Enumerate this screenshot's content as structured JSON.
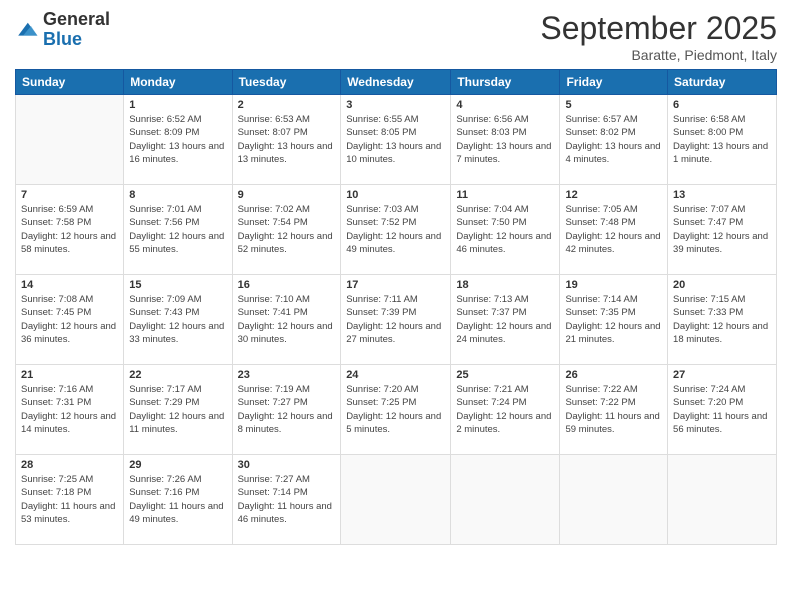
{
  "logo": {
    "general": "General",
    "blue": "Blue"
  },
  "header": {
    "month": "September 2025",
    "location": "Baratte, Piedmont, Italy"
  },
  "days_of_week": [
    "Sunday",
    "Monday",
    "Tuesday",
    "Wednesday",
    "Thursday",
    "Friday",
    "Saturday"
  ],
  "weeks": [
    [
      {
        "day": "",
        "sunrise": "",
        "sunset": "",
        "daylight": ""
      },
      {
        "day": "1",
        "sunrise": "Sunrise: 6:52 AM",
        "sunset": "Sunset: 8:09 PM",
        "daylight": "Daylight: 13 hours and 16 minutes."
      },
      {
        "day": "2",
        "sunrise": "Sunrise: 6:53 AM",
        "sunset": "Sunset: 8:07 PM",
        "daylight": "Daylight: 13 hours and 13 minutes."
      },
      {
        "day": "3",
        "sunrise": "Sunrise: 6:55 AM",
        "sunset": "Sunset: 8:05 PM",
        "daylight": "Daylight: 13 hours and 10 minutes."
      },
      {
        "day": "4",
        "sunrise": "Sunrise: 6:56 AM",
        "sunset": "Sunset: 8:03 PM",
        "daylight": "Daylight: 13 hours and 7 minutes."
      },
      {
        "day": "5",
        "sunrise": "Sunrise: 6:57 AM",
        "sunset": "Sunset: 8:02 PM",
        "daylight": "Daylight: 13 hours and 4 minutes."
      },
      {
        "day": "6",
        "sunrise": "Sunrise: 6:58 AM",
        "sunset": "Sunset: 8:00 PM",
        "daylight": "Daylight: 13 hours and 1 minute."
      }
    ],
    [
      {
        "day": "7",
        "sunrise": "Sunrise: 6:59 AM",
        "sunset": "Sunset: 7:58 PM",
        "daylight": "Daylight: 12 hours and 58 minutes."
      },
      {
        "day": "8",
        "sunrise": "Sunrise: 7:01 AM",
        "sunset": "Sunset: 7:56 PM",
        "daylight": "Daylight: 12 hours and 55 minutes."
      },
      {
        "day": "9",
        "sunrise": "Sunrise: 7:02 AM",
        "sunset": "Sunset: 7:54 PM",
        "daylight": "Daylight: 12 hours and 52 minutes."
      },
      {
        "day": "10",
        "sunrise": "Sunrise: 7:03 AM",
        "sunset": "Sunset: 7:52 PM",
        "daylight": "Daylight: 12 hours and 49 minutes."
      },
      {
        "day": "11",
        "sunrise": "Sunrise: 7:04 AM",
        "sunset": "Sunset: 7:50 PM",
        "daylight": "Daylight: 12 hours and 46 minutes."
      },
      {
        "day": "12",
        "sunrise": "Sunrise: 7:05 AM",
        "sunset": "Sunset: 7:48 PM",
        "daylight": "Daylight: 12 hours and 42 minutes."
      },
      {
        "day": "13",
        "sunrise": "Sunrise: 7:07 AM",
        "sunset": "Sunset: 7:47 PM",
        "daylight": "Daylight: 12 hours and 39 minutes."
      }
    ],
    [
      {
        "day": "14",
        "sunrise": "Sunrise: 7:08 AM",
        "sunset": "Sunset: 7:45 PM",
        "daylight": "Daylight: 12 hours and 36 minutes."
      },
      {
        "day": "15",
        "sunrise": "Sunrise: 7:09 AM",
        "sunset": "Sunset: 7:43 PM",
        "daylight": "Daylight: 12 hours and 33 minutes."
      },
      {
        "day": "16",
        "sunrise": "Sunrise: 7:10 AM",
        "sunset": "Sunset: 7:41 PM",
        "daylight": "Daylight: 12 hours and 30 minutes."
      },
      {
        "day": "17",
        "sunrise": "Sunrise: 7:11 AM",
        "sunset": "Sunset: 7:39 PM",
        "daylight": "Daylight: 12 hours and 27 minutes."
      },
      {
        "day": "18",
        "sunrise": "Sunrise: 7:13 AM",
        "sunset": "Sunset: 7:37 PM",
        "daylight": "Daylight: 12 hours and 24 minutes."
      },
      {
        "day": "19",
        "sunrise": "Sunrise: 7:14 AM",
        "sunset": "Sunset: 7:35 PM",
        "daylight": "Daylight: 12 hours and 21 minutes."
      },
      {
        "day": "20",
        "sunrise": "Sunrise: 7:15 AM",
        "sunset": "Sunset: 7:33 PM",
        "daylight": "Daylight: 12 hours and 18 minutes."
      }
    ],
    [
      {
        "day": "21",
        "sunrise": "Sunrise: 7:16 AM",
        "sunset": "Sunset: 7:31 PM",
        "daylight": "Daylight: 12 hours and 14 minutes."
      },
      {
        "day": "22",
        "sunrise": "Sunrise: 7:17 AM",
        "sunset": "Sunset: 7:29 PM",
        "daylight": "Daylight: 12 hours and 11 minutes."
      },
      {
        "day": "23",
        "sunrise": "Sunrise: 7:19 AM",
        "sunset": "Sunset: 7:27 PM",
        "daylight": "Daylight: 12 hours and 8 minutes."
      },
      {
        "day": "24",
        "sunrise": "Sunrise: 7:20 AM",
        "sunset": "Sunset: 7:25 PM",
        "daylight": "Daylight: 12 hours and 5 minutes."
      },
      {
        "day": "25",
        "sunrise": "Sunrise: 7:21 AM",
        "sunset": "Sunset: 7:24 PM",
        "daylight": "Daylight: 12 hours and 2 minutes."
      },
      {
        "day": "26",
        "sunrise": "Sunrise: 7:22 AM",
        "sunset": "Sunset: 7:22 PM",
        "daylight": "Daylight: 11 hours and 59 minutes."
      },
      {
        "day": "27",
        "sunrise": "Sunrise: 7:24 AM",
        "sunset": "Sunset: 7:20 PM",
        "daylight": "Daylight: 11 hours and 56 minutes."
      }
    ],
    [
      {
        "day": "28",
        "sunrise": "Sunrise: 7:25 AM",
        "sunset": "Sunset: 7:18 PM",
        "daylight": "Daylight: 11 hours and 53 minutes."
      },
      {
        "day": "29",
        "sunrise": "Sunrise: 7:26 AM",
        "sunset": "Sunset: 7:16 PM",
        "daylight": "Daylight: 11 hours and 49 minutes."
      },
      {
        "day": "30",
        "sunrise": "Sunrise: 7:27 AM",
        "sunset": "Sunset: 7:14 PM",
        "daylight": "Daylight: 11 hours and 46 minutes."
      },
      {
        "day": "",
        "sunrise": "",
        "sunset": "",
        "daylight": ""
      },
      {
        "day": "",
        "sunrise": "",
        "sunset": "",
        "daylight": ""
      },
      {
        "day": "",
        "sunrise": "",
        "sunset": "",
        "daylight": ""
      },
      {
        "day": "",
        "sunrise": "",
        "sunset": "",
        "daylight": ""
      }
    ]
  ]
}
